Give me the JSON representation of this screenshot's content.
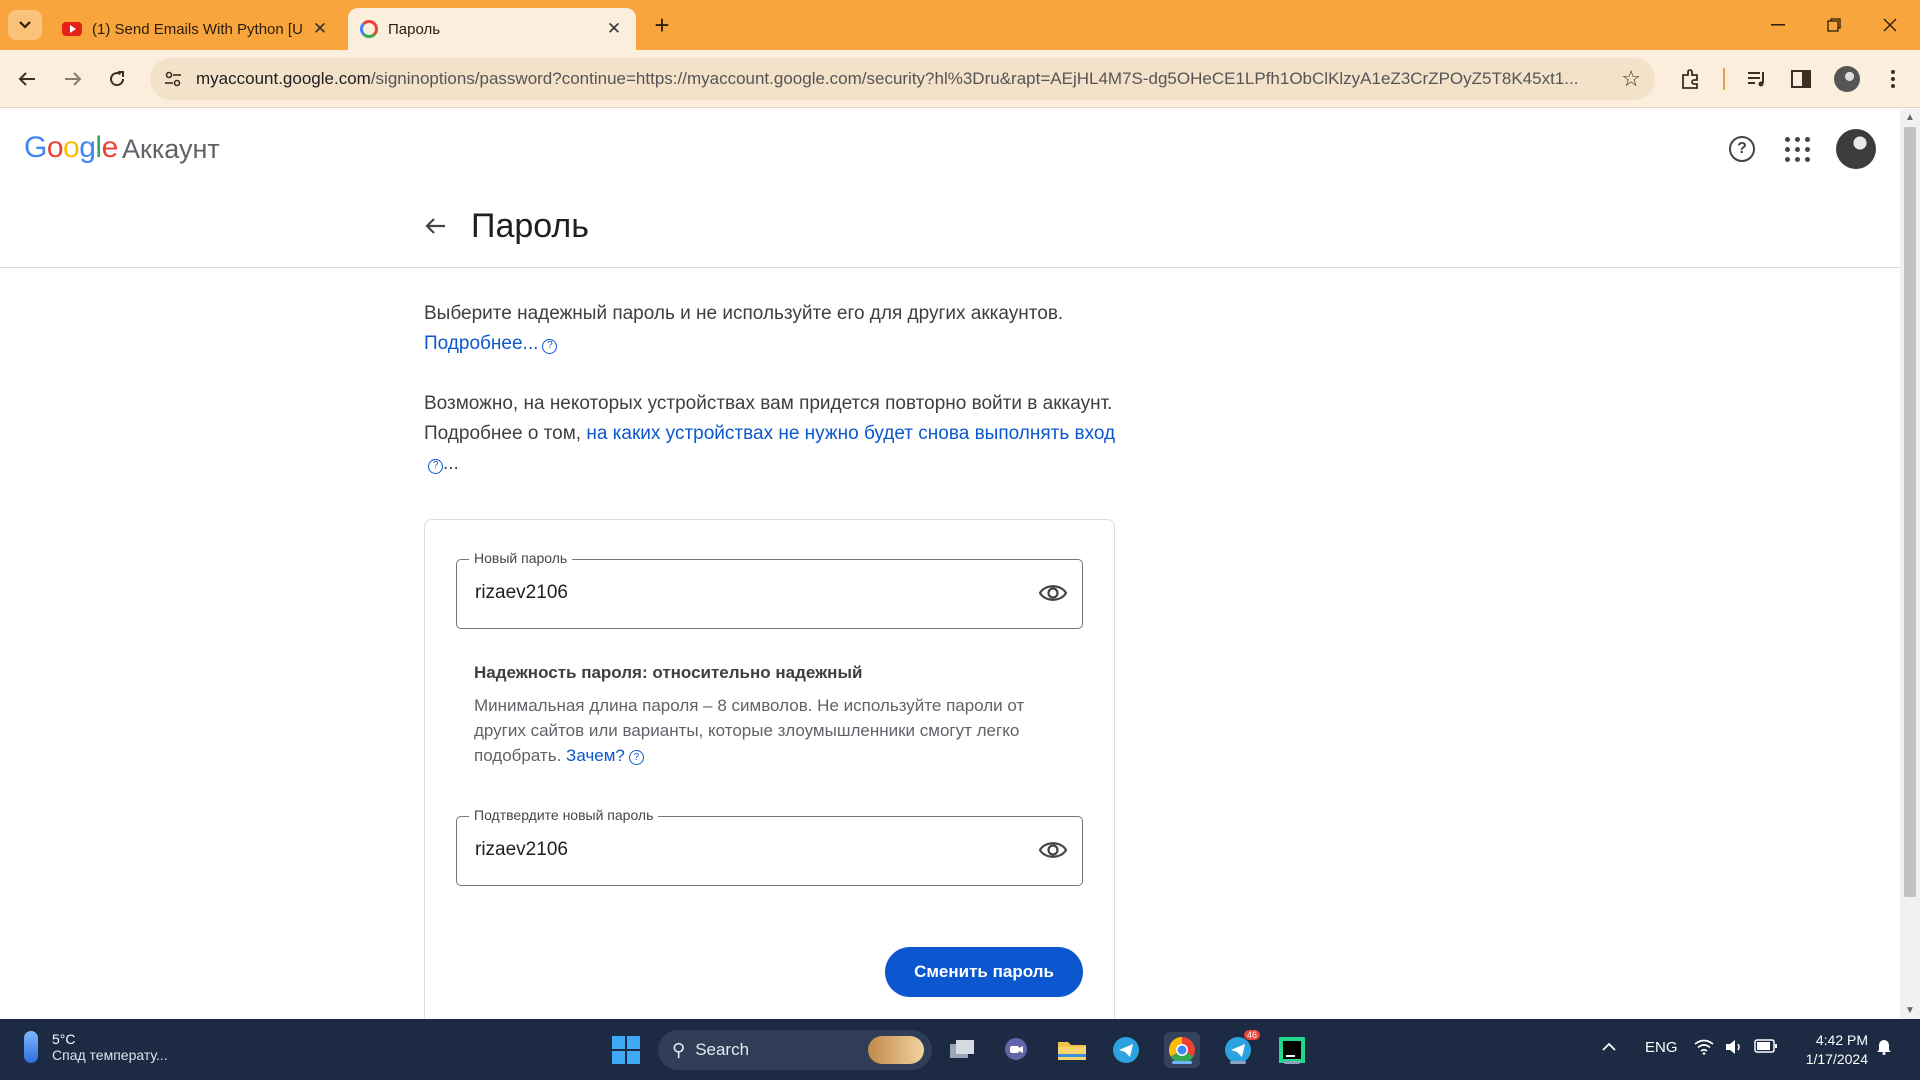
{
  "browser": {
    "tabs": [
      {
        "title": "(1) Send Emails With Python [U",
        "favicon": "youtube-icon",
        "active": false
      },
      {
        "title": "Пароль",
        "favicon": "google-icon",
        "active": true
      }
    ],
    "url_host": "myaccount.google.com",
    "url_rest": "/signinoptions/password?continue=https://myaccount.google.com/security?hl%3Dru&rapt=AEjHL4M7S-dg5OHeCE1LPfh1ObClKlzyA1eZ3CrZPOyZ5T8K45xt1..."
  },
  "header": {
    "logo_letters": [
      "G",
      "o",
      "o",
      "g",
      "l",
      "e"
    ],
    "product": "Аккаунт"
  },
  "page": {
    "title": "Пароль",
    "intro": "Выберите надежный пароль и не используйте его для других аккаунтов.",
    "learn_more": "Подробнее...",
    "devices_text": "Возможно, на некоторых устройствах вам придется повторно войти в аккаунт. Подробнее о том, ",
    "devices_link": "на каких устройствах не нужно будет снова выполнять вход",
    "devices_suffix": "...",
    "new_password_label": "Новый пароль",
    "new_password_value": "rizaev2106",
    "strength_title": "Надежность пароля: относительно надежный",
    "strength_text": "Минимальная длина пароля – 8 символов. Не используйте пароли от других сайтов или варианты, которые злоумышленники смогут легко подобрать.",
    "why_link": "Зачем?",
    "confirm_password_label": "Подтвердите новый пароль",
    "confirm_password_value": "rizaev2106",
    "submit_label": "Сменить пароль"
  },
  "taskbar": {
    "weather_temp": "5°C",
    "weather_desc": "Спад температу...",
    "search_label": "Search",
    "language": "ENG",
    "time": "4:42 PM",
    "date": "1/17/2024",
    "telegram_badge": "46"
  },
  "colors": {
    "chrome_tabbar": "#f7a53c",
    "chrome_toolbar": "#fbeedd",
    "link_blue": "#0b57d0",
    "taskbar": "#1c2a43"
  }
}
